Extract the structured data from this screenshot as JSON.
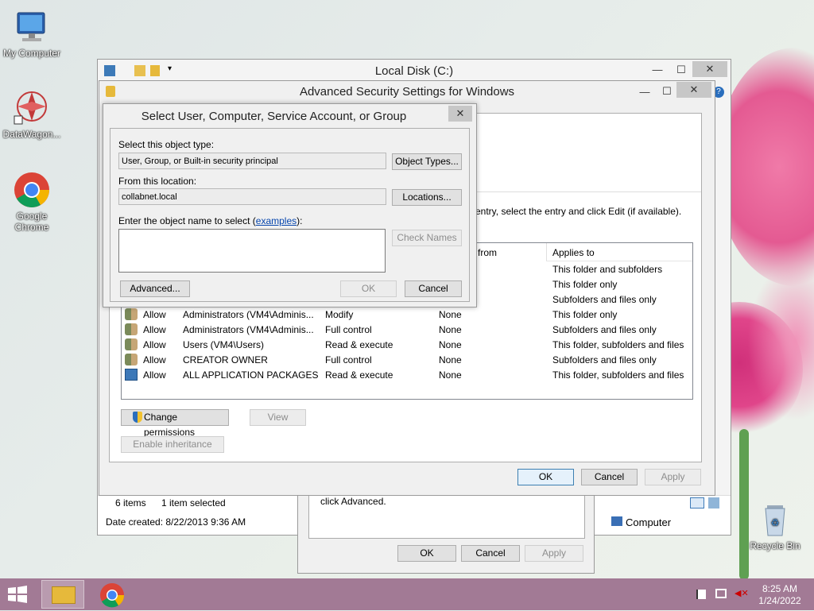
{
  "desktop": {
    "icons": [
      {
        "label": "My Computer"
      },
      {
        "label": "DataWagon..."
      },
      {
        "label": "Google Chrome"
      },
      {
        "label": "Recycle Bin"
      }
    ]
  },
  "explorer": {
    "title": "Local Disk (C:)",
    "status_items": "6 items",
    "status_selected": "1 item selected",
    "date_created": "Date created: 8/22/2013 9:36 AM",
    "location": "Computer"
  },
  "props_dialog": {
    "advanced_hint": "click Advanced.",
    "ok": "OK",
    "cancel": "Cancel",
    "apply": "Apply"
  },
  "adv_security": {
    "title": "Advanced Security Settings for Windows",
    "hint": "entry, select the entry and click Edit (if available).",
    "col_inherited": "from",
    "col_applies": "Applies to",
    "rows": [
      {
        "type": "",
        "principal": "",
        "access": "",
        "inherited": "",
        "applies": "This folder and subfolders"
      },
      {
        "type": "",
        "principal": "",
        "access": "",
        "inherited": "",
        "applies": "This folder only"
      },
      {
        "type": "",
        "principal": "",
        "access": "",
        "inherited": "",
        "applies": "Subfolders and files only"
      },
      {
        "type": "Allow",
        "principal": "Administrators (VM4\\Adminis...",
        "access": "Modify",
        "inherited": "None",
        "applies": "This folder only"
      },
      {
        "type": "Allow",
        "principal": "Administrators (VM4\\Adminis...",
        "access": "Full control",
        "inherited": "None",
        "applies": "Subfolders and files only"
      },
      {
        "type": "Allow",
        "principal": "Users (VM4\\Users)",
        "access": "Read & execute",
        "inherited": "None",
        "applies": "This folder, subfolders and files"
      },
      {
        "type": "Allow",
        "principal": "CREATOR OWNER",
        "access": "Full control",
        "inherited": "None",
        "applies": "Subfolders and files only"
      },
      {
        "type": "Allow",
        "principal": "ALL APPLICATION PACKAGES",
        "access": "Read & execute",
        "inherited": "None",
        "applies": "This folder, subfolders and files"
      }
    ],
    "change_permissions": "Change permissions",
    "view": "View",
    "enable_inheritance": "Enable inheritance",
    "ok": "OK",
    "cancel": "Cancel",
    "apply": "Apply"
  },
  "select_dialog": {
    "title": "Select User, Computer, Service Account, or Group",
    "object_type_label": "Select this object type:",
    "object_type_value": "User, Group, or Built-in security principal",
    "object_types_btn": "Object Types...",
    "location_label": "From this location:",
    "location_value": "collabnet.local",
    "locations_btn": "Locations...",
    "enter_label_pre": "Enter the object name to select (",
    "examples_link": "examples",
    "enter_label_post": "):",
    "check_names": "Check Names",
    "advanced": "Advanced...",
    "ok": "OK",
    "cancel": "Cancel"
  },
  "taskbar": {
    "time": "8:25 AM",
    "date": "1/24/2022"
  }
}
